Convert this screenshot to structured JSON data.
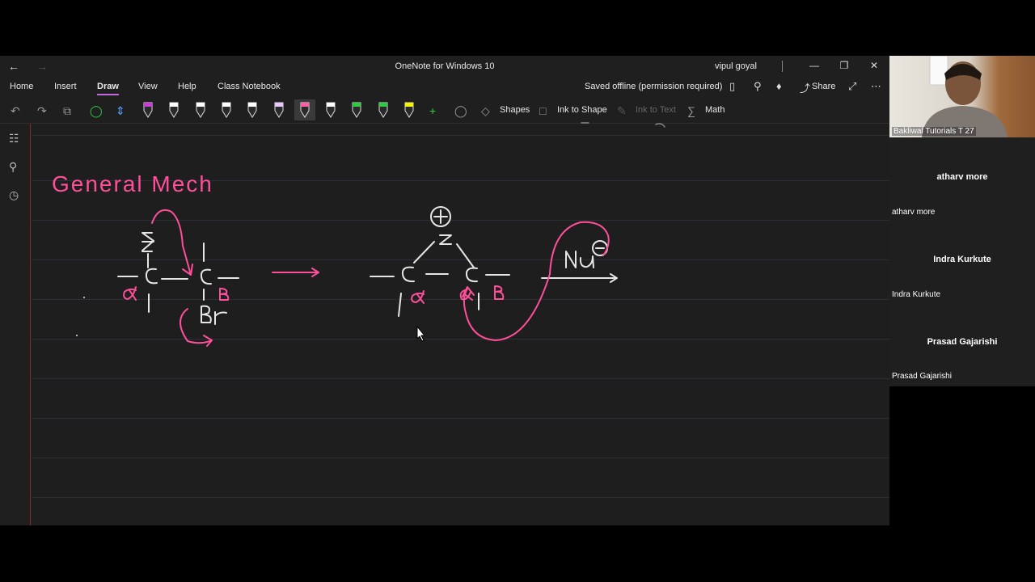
{
  "window": {
    "title": "OneNote for Windows 10",
    "user": "vipul goyal"
  },
  "menu": {
    "tabs": [
      "Home",
      "Insert",
      "Draw",
      "View",
      "Help",
      "Class Notebook"
    ],
    "active_tab": "Draw",
    "saved_status": "Saved offline (permission required)",
    "share_label": "Share"
  },
  "ribbon": {
    "pen_colors": [
      "#c83cd8",
      "#ffffff",
      "#ffffff",
      "#ffffff",
      "#ffffff",
      "#e8c8ff",
      "#ff5fa8",
      "#ffffff",
      "#2ecc40",
      "#2ecc40",
      "#f4f400"
    ],
    "selected_pen_index": 6,
    "shapes_label": "Shapes",
    "ink_to_shape_label": "Ink to Shape",
    "ink_to_text_label": "Ink to Text",
    "math_label": "Math"
  },
  "meeting": {
    "self_name": "Bakliwal Tutorials T 27",
    "participants": [
      {
        "display": "atharv more",
        "label": "atharv more"
      },
      {
        "display": "Indra Kurkute",
        "label": "Indra Kurkute"
      },
      {
        "display": "Prasad Gajarishi",
        "label": "Prasad Gajarishi"
      }
    ]
  },
  "notes": {
    "heading": "General Mech",
    "colors": {
      "pink": "#ff4f9a",
      "white": "#e6e6e6"
    }
  }
}
